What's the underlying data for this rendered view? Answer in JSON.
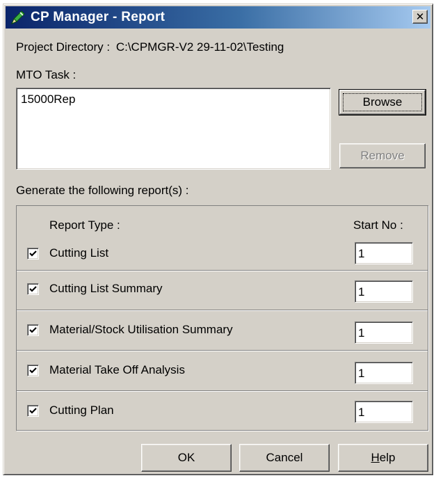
{
  "window": {
    "title": "CP Manager - Report",
    "close_glyph": "✕",
    "app_icon": "pen-icon"
  },
  "project": {
    "label": "Project Directory :",
    "path": "C:\\CPMGR-V2 29-11-02\\Testing"
  },
  "mto": {
    "label": "MTO Task :",
    "items": [
      "15000Rep"
    ],
    "browse_label": "Browse",
    "remove_label": "Remove"
  },
  "reports": {
    "label": "Generate the following report(s) :",
    "col_type": "Report Type :",
    "col_start": "Start No :",
    "rows": [
      {
        "name": "Cutting List",
        "checked": true,
        "start": "1"
      },
      {
        "name": "Cutting List Summary",
        "checked": true,
        "start": "1"
      },
      {
        "name": "Material/Stock Utilisation Summary",
        "checked": true,
        "start": "1"
      },
      {
        "name": "Material Take Off Analysis",
        "checked": true,
        "start": "1"
      },
      {
        "name": "Cutting Plan",
        "checked": true,
        "start": "1"
      }
    ]
  },
  "footer": {
    "ok_label": "OK",
    "cancel_label": "Cancel",
    "help_label_first": "H",
    "help_label_rest": "elp"
  },
  "colors": {
    "title_start": "#0a246a",
    "title_end": "#a6caf0",
    "face": "#d4d0c8"
  }
}
